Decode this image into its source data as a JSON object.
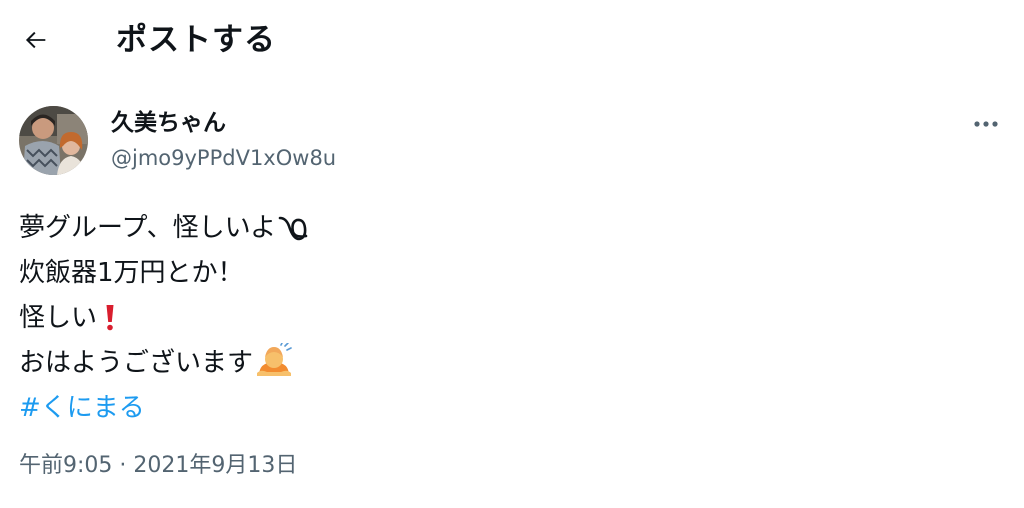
{
  "header": {
    "back_icon": "arrow-left-icon",
    "title": "ポストする"
  },
  "author": {
    "avatar_icon": "profile-photo",
    "display_name": "久美ちゃん",
    "handle": "@jmo9yPPdV1xOw8u",
    "more_icon": "more-horizontal-icon"
  },
  "tweet": {
    "lines": [
      {
        "text": "夢グループ、怪しいよ",
        "emoji": "curly-loop-icon"
      },
      {
        "text": "炊飯器1万円とか！"
      },
      {
        "text": "怪しい",
        "emoji": "red-exclamation-icon"
      },
      {
        "text": "おはようございます",
        "emoji": "person-bowing-icon"
      }
    ],
    "hashtag": "#くにまる"
  },
  "timestamp": {
    "time": "午前9:05",
    "separator": " · ",
    "date": "2021年9月13日"
  },
  "colors": {
    "text": "#0f1419",
    "secondary": "#536471",
    "link": "#1d9bf0"
  }
}
